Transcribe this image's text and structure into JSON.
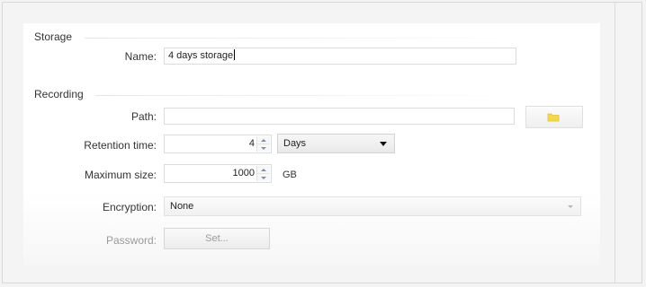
{
  "storage": {
    "group_label": "Storage",
    "name_label": "Name:",
    "name_value": "4 days storage"
  },
  "recording": {
    "group_label": "Recording",
    "path_label": "Path:",
    "path_value": "",
    "retention_label": "Retention time:",
    "retention_value": "4",
    "retention_unit": "Days",
    "max_size_label": "Maximum size:",
    "max_size_value": "1000",
    "max_size_unit": "GB",
    "encryption_label": "Encryption:",
    "encryption_value": "None",
    "password_label": "Password:",
    "password_button": "Set..."
  },
  "icons": {
    "browse": "folder-icon",
    "spinner_up": "spin-up-icon",
    "spinner_down": "spin-down-icon",
    "dropdown": "chevron-down-icon"
  },
  "colors": {
    "folder_icon": "#f2d84a",
    "disabled_text": "#9a9a9a"
  }
}
